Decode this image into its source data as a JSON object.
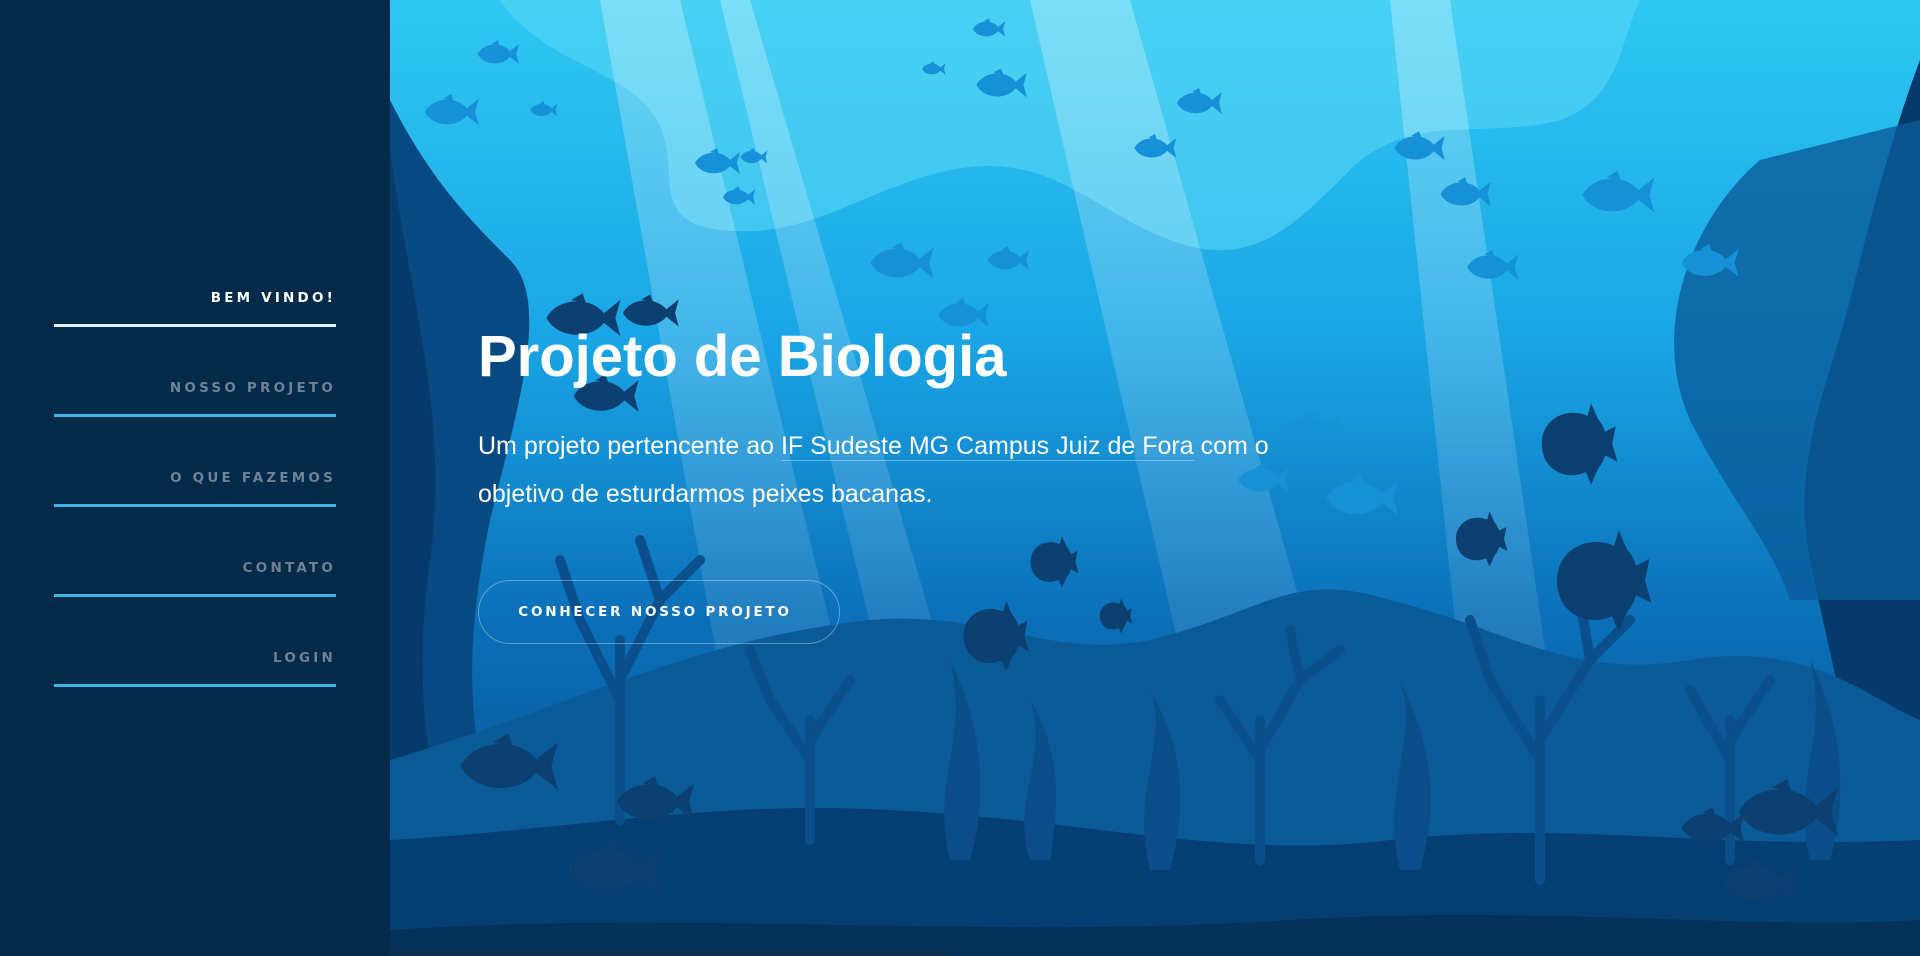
{
  "nav": {
    "items": [
      {
        "label": "BEM VINDO!",
        "active": true
      },
      {
        "label": "NOSSO PROJETO",
        "active": false
      },
      {
        "label": "O QUE FAZEMOS",
        "active": false
      },
      {
        "label": "CONTATO",
        "active": false
      },
      {
        "label": "LOGIN",
        "active": false
      }
    ]
  },
  "hero": {
    "title": "Projeto de Biologia",
    "text_before": "Um projeto pertencente ao ",
    "text_link": "IF Sudeste MG Campus Juiz de Fora",
    "text_after": " com o objetivo de esturdarmos peixes bacanas.",
    "cta_label": "CONHECER NOSSO PROJETO"
  },
  "colors": {
    "sidebar_bg": "#032a48",
    "nav_underline": "#41b5e4",
    "nav_active_text": "#ffffff",
    "nav_inactive_text": "#6f8397",
    "ocean_light": "#2ec6f0",
    "ocean_deep": "#04294a"
  },
  "icons": [
    "fish-silhouette-icon",
    "coral-silhouette-icon"
  ]
}
